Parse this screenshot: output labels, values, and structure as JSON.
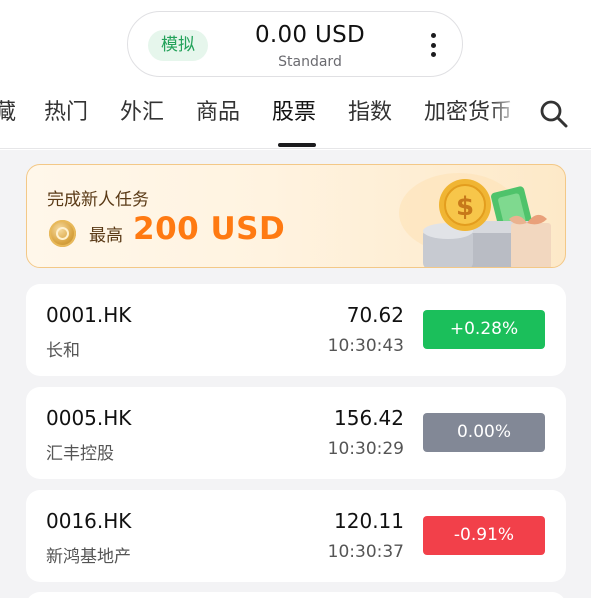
{
  "account": {
    "mode": "模拟",
    "balance": "0.00 USD",
    "type": "Standard"
  },
  "tabs": [
    {
      "label": "藏"
    },
    {
      "label": "热门"
    },
    {
      "label": "外汇"
    },
    {
      "label": "商品"
    },
    {
      "label": "股票",
      "active": true
    },
    {
      "label": "指数"
    },
    {
      "label": "加密货币"
    }
  ],
  "banner": {
    "title": "完成新人任务",
    "max_label": "最高",
    "amount": "200 USD"
  },
  "stocks": [
    {
      "symbol": "0001.HK",
      "name": "长和",
      "price": "70.62",
      "time": "10:30:43",
      "change": "+0.28%",
      "color": "#1bbf5b"
    },
    {
      "symbol": "0005.HK",
      "name": "汇丰控股",
      "price": "156.42",
      "time": "10:30:29",
      "change": "0.00%",
      "color": "#828896"
    },
    {
      "symbol": "0016.HK",
      "name": "新鸿基地产",
      "price": "120.11",
      "time": "10:30:37",
      "change": "-0.91%",
      "color": "#f2404a"
    }
  ],
  "colors": {
    "up": "#1bbf5b",
    "flat": "#828896",
    "down": "#f2404a",
    "accent": "#ff7a12",
    "demo_badge": "#23a25a"
  },
  "icons": [
    "more-vertical-icon",
    "search-icon",
    "coin-icon",
    "gift-money-illustration"
  ]
}
